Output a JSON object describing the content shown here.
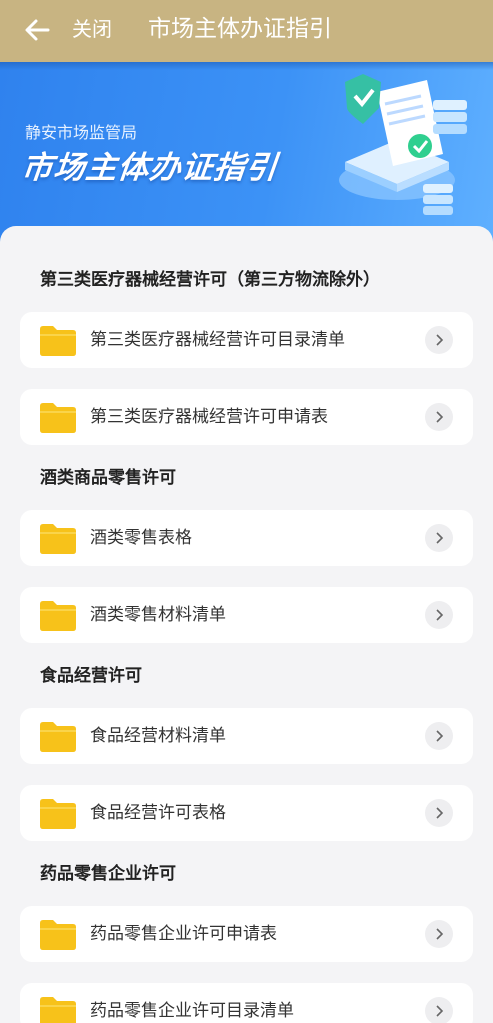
{
  "header": {
    "close_label": "关闭",
    "title": "市场主体办证指引"
  },
  "banner": {
    "subtitle": "静安市场监管局",
    "main_title": "市场主体办证指引"
  },
  "sections": [
    {
      "title": "第三类医疗器械经营许可（第三方物流除外）",
      "items": [
        "第三类医疗器械经营许可目录清单",
        "第三类医疗器械经营许可申请表"
      ]
    },
    {
      "title": "酒类商品零售许可",
      "items": [
        "酒类零售表格",
        "酒类零售材料清单"
      ]
    },
    {
      "title": "食品经营许可",
      "items": [
        "食品经营材料清单",
        "食品经营许可表格"
      ]
    },
    {
      "title": "药品零售企业许可",
      "items": [
        "药品零售企业许可申请表",
        "药品零售企业许可目录清单"
      ]
    }
  ],
  "colors": {
    "topbar": "#c8b482",
    "banner": "#3c92f6",
    "folder": "#f7c21a",
    "background": "#f4f4f6"
  },
  "icons": {
    "back": "back-arrow-icon",
    "folder": "folder-icon",
    "chevron": "chevron-right-icon"
  }
}
